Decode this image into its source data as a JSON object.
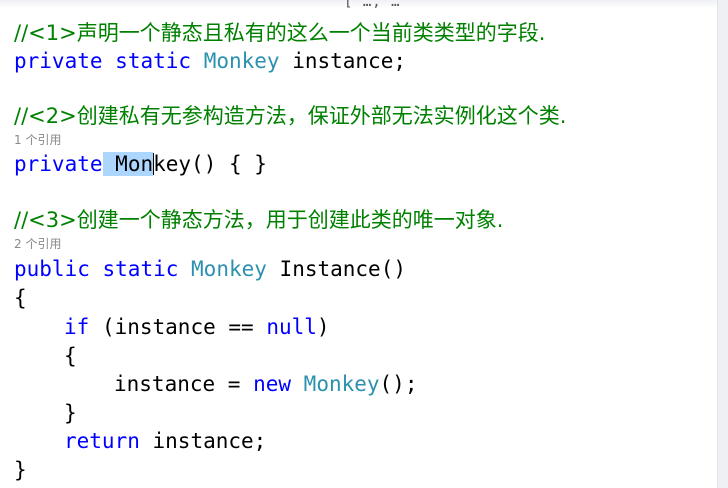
{
  "top_fragment": "[ …, …",
  "comment1": "//<1>声明一个静态且私有的这么一个当前类类型的字段.",
  "field_line": {
    "kw1": "private",
    "kw2": "static",
    "type": "Monkey",
    "rest": "instance;"
  },
  "comment2": "//<2>创建私有无参构造方法，保证外部无法实例化这个类.",
  "ref1": "1 个引用",
  "ctor_line": {
    "kw": "private",
    "sel_a": "Mon",
    "sel_b": "k",
    "rest": "ey() { }"
  },
  "comment3": "//<3>创建一个静态方法，用于创建此类的唯一对象.",
  "ref2": "2 个引用",
  "method_sig": {
    "kw1": "public",
    "kw2": "static",
    "type": "Monkey",
    "rest": "Instance()"
  },
  "brace_open": "{",
  "if_line": {
    "kw": "if",
    "mid": "(instance == ",
    "null": "null",
    "end": ")"
  },
  "inner_brace_open": "{",
  "assign_line": {
    "lhs": "instance = ",
    "kw": "new",
    "type": "Monkey",
    "end": "();"
  },
  "inner_brace_close": "}",
  "return_line": {
    "kw": "return",
    "rest": "instance;"
  },
  "brace_close": "}",
  "colors": {
    "comment": "#008000",
    "keyword": "#0000ff",
    "type": "#2b91af",
    "selection": "#add6ff"
  }
}
